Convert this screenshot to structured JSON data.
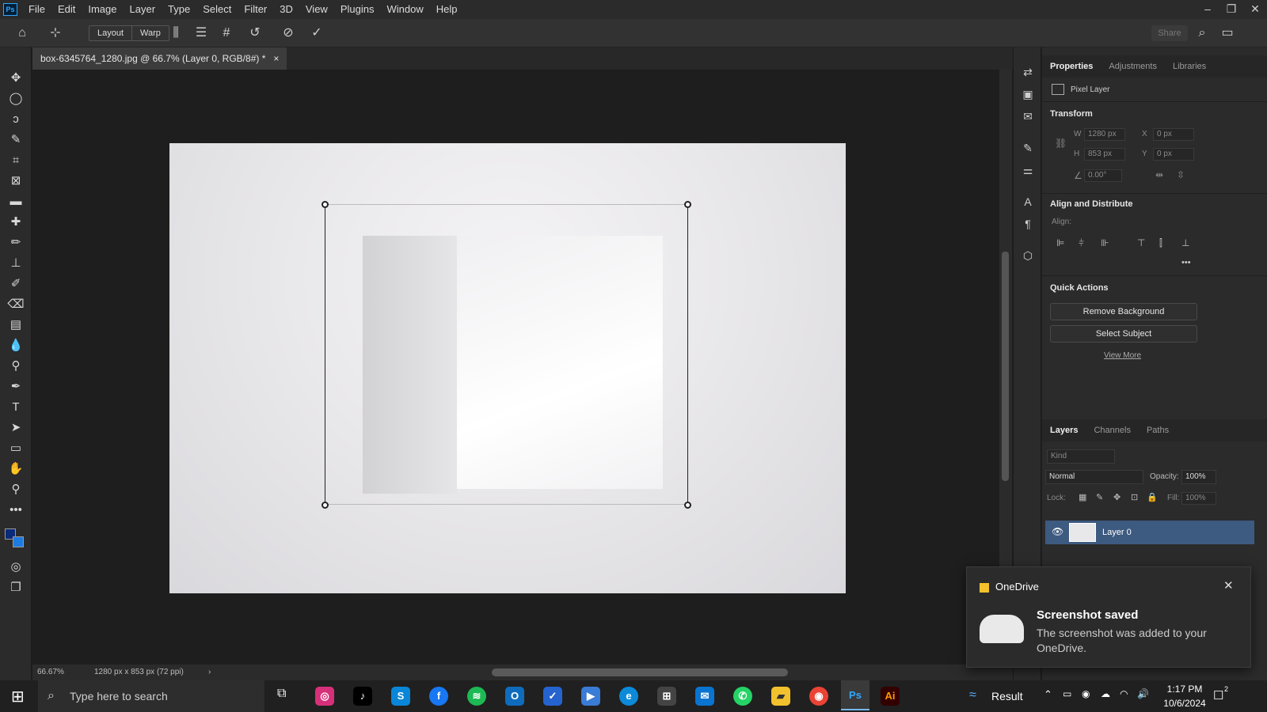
{
  "app": {
    "logo": "Ps"
  },
  "menubar": {
    "items": [
      "File",
      "Edit",
      "Image",
      "Layer",
      "Type",
      "Select",
      "Filter",
      "3D",
      "View",
      "Plugins",
      "Window",
      "Help"
    ]
  },
  "window_controls": {
    "minimize": "–",
    "restore": "❐",
    "close": "✕"
  },
  "options_bar": {
    "layout_label": "Layout",
    "warp_label": "Warp",
    "share_label": "Share"
  },
  "document": {
    "tab_title": "box-6345764_1280.jpg @ 66.7% (Layer 0, RGB/8#) *",
    "close": "×"
  },
  "statusbar": {
    "zoom": "66.67%",
    "doc_info": "1280 px x 853 px (72 ppi)"
  },
  "properties": {
    "tabs": [
      "Properties",
      "Adjustments",
      "Libraries"
    ],
    "layer_type": "Pixel Layer",
    "transform": {
      "title": "Transform",
      "w_label": "W",
      "w_value": "1280 px",
      "h_label": "H",
      "h_value": "853 px",
      "x_label": "X",
      "x_value": "0 px",
      "y_label": "Y",
      "y_value": "0 px",
      "angle_value": "0.00°"
    },
    "align": {
      "title": "Align and Distribute",
      "align_label": "Align:",
      "more": "•••"
    },
    "quick_actions": {
      "title": "Quick Actions",
      "remove_bg": "Remove Background",
      "select_subject": "Select Subject",
      "view_more": "View More"
    }
  },
  "layers_panel": {
    "tabs": [
      "Layers",
      "Channels",
      "Paths"
    ],
    "kind_placeholder": "Kind",
    "blend_mode": "Normal",
    "opacity_label": "Opacity:",
    "opacity_value": "100%",
    "lock_label": "Lock:",
    "fill_label": "Fill:",
    "fill_value": "100%",
    "layers": [
      {
        "name": "Layer 0",
        "visible": true,
        "selected": true
      }
    ]
  },
  "notification": {
    "app_name": "OneDrive",
    "title": "Screenshot saved",
    "body": "The screenshot was added to your OneDrive."
  },
  "taskbar": {
    "search_placeholder": "Type here to search",
    "weather_label": "Result",
    "time": "1:17 PM",
    "date": "10/6/2024",
    "notification_count": "2"
  },
  "colors": {
    "accent": "#31a8ff",
    "foreground_swatch": "#0a2a7a",
    "background_swatch": "#1e7be0",
    "selected_layer": "#3d5a80"
  }
}
